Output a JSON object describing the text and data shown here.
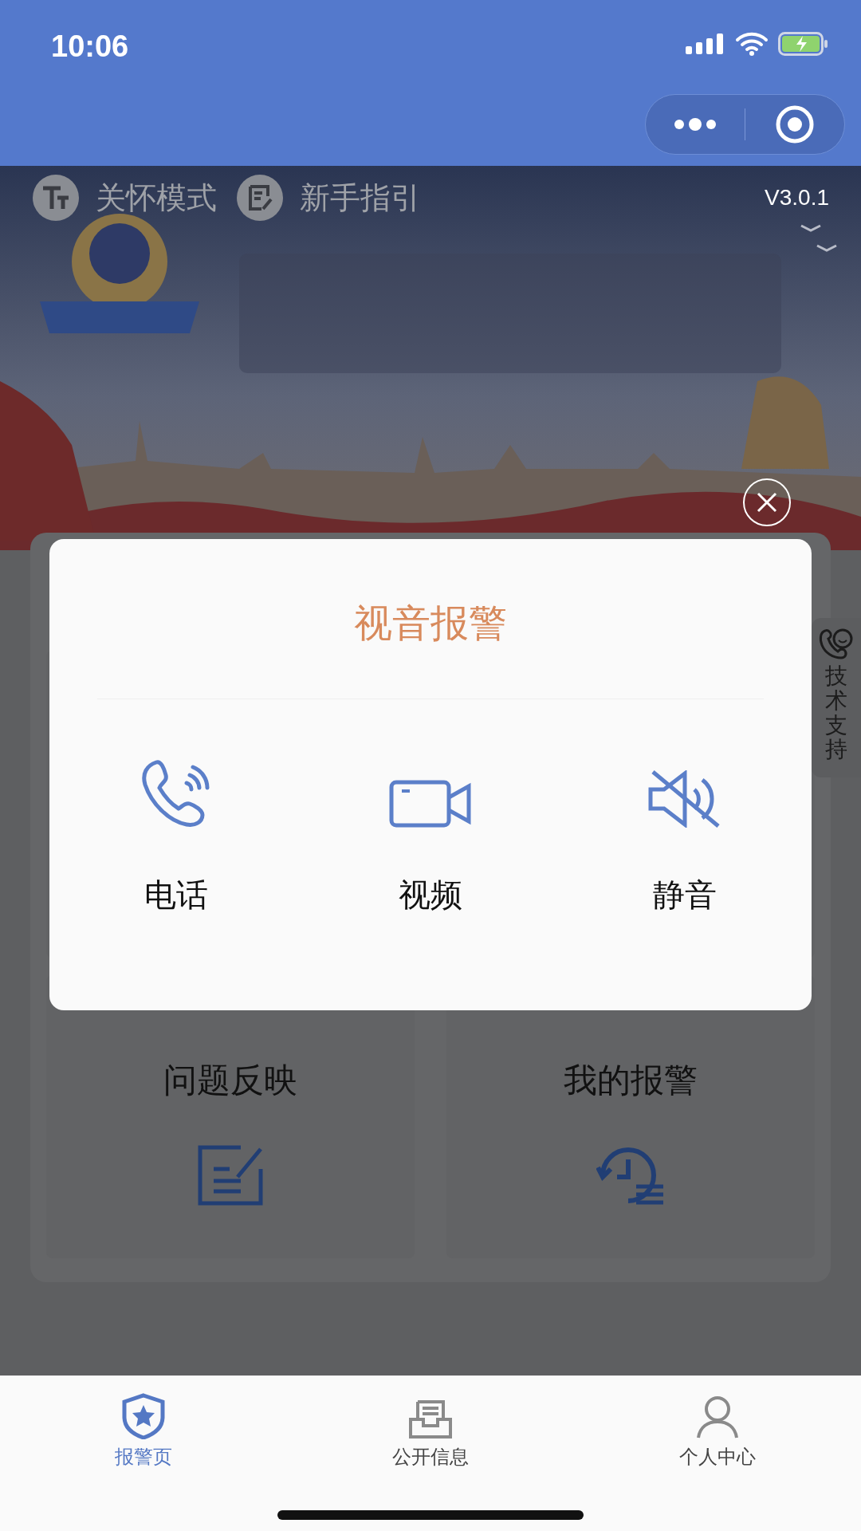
{
  "status_bar": {
    "time": "10:06"
  },
  "banner": {
    "links": [
      {
        "label": "关怀模式",
        "kind": "text-size"
      },
      {
        "label": "新手指引",
        "kind": "guide"
      }
    ],
    "version": "V3.0.1"
  },
  "cards": [
    {
      "label": "问题反映",
      "kind": "edit"
    },
    {
      "label": "我的报警",
      "kind": "history"
    }
  ],
  "side_tab": {
    "label": "技术支持"
  },
  "dialog": {
    "title": "视音报警",
    "options": [
      {
        "label": "电话",
        "kind": "phone"
      },
      {
        "label": "视频",
        "kind": "video"
      },
      {
        "label": "静音",
        "kind": "mute"
      }
    ]
  },
  "tab_bar": [
    {
      "label": "报警页",
      "selected": true,
      "kind": "shield"
    },
    {
      "label": "公开信息",
      "selected": false,
      "kind": "inbox"
    },
    {
      "label": "个人中心",
      "selected": false,
      "kind": "person"
    }
  ]
}
